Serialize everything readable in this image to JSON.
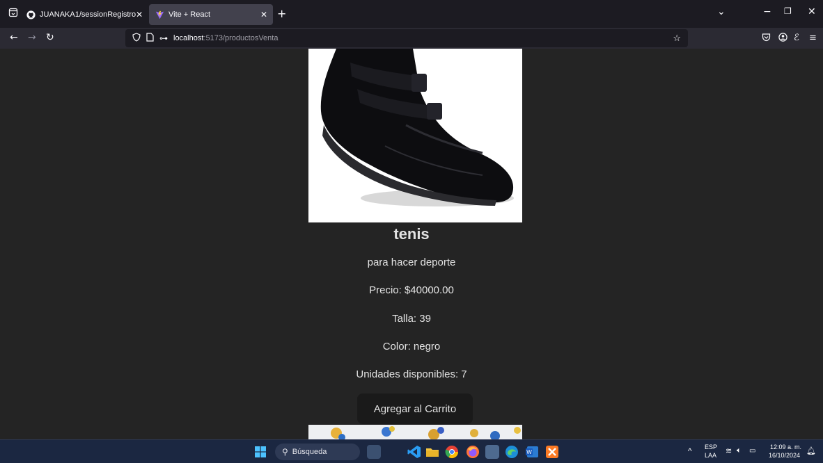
{
  "browser": {
    "tabs": [
      {
        "title": "JUANAKA1/sessionRegistro",
        "icon": "github-icon",
        "active": false
      },
      {
        "title": "Vite + React",
        "icon": "vite-icon",
        "active": true
      }
    ],
    "url_host": "localhost",
    "url_path": ":5173/productosVenta"
  },
  "product": {
    "name": "tenis",
    "description": "para hacer deporte",
    "price": "Precio: $40000.00",
    "size": "Talla: 39",
    "color": "Color: negro",
    "stock": "Unidades disponibles: 7",
    "add_to_cart_label": "Agregar al Carrito"
  },
  "taskbar": {
    "search_placeholder": "Búsqueda",
    "lang_top": "ESP",
    "lang_bottom": "LAA",
    "time": "12:09 a. m.",
    "date": "16/10/2024"
  }
}
